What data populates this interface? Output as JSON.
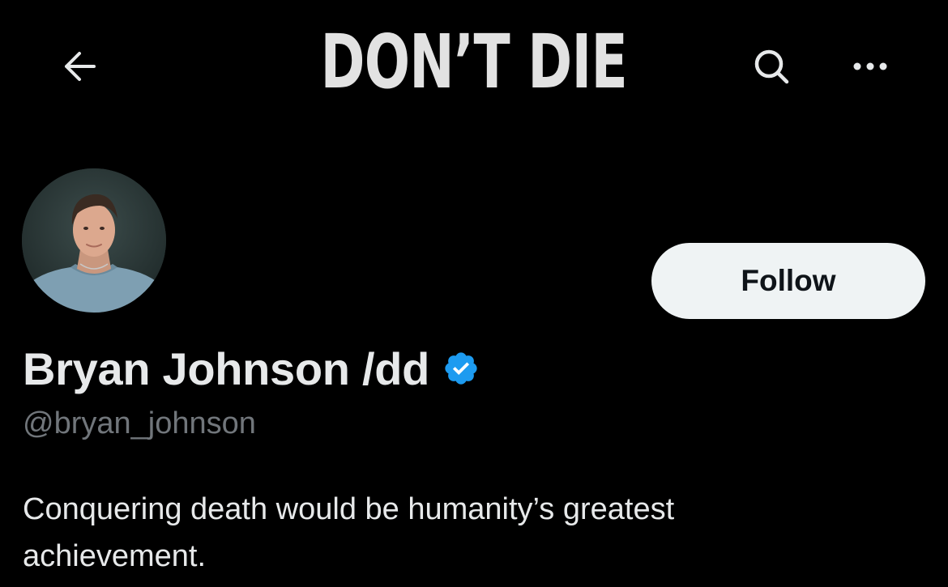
{
  "header": {
    "banner_title": "DON’T DIE",
    "back_icon": "arrow-left-icon",
    "search_icon": "search-icon",
    "more_icon": "more-horizontal-icon"
  },
  "profile": {
    "display_name": "Bryan Johnson /dd",
    "handle": "@bryan_johnson",
    "verified": true,
    "bio": "Conquering death would be humanity’s greatest achievement.",
    "follow_label": "Follow"
  },
  "colors": {
    "background": "#000000",
    "text_primary": "#e7e9ea",
    "text_secondary": "#71767b",
    "verified_blue": "#1d9bf0",
    "follow_bg": "#eff3f4",
    "follow_text": "#0f1419"
  }
}
